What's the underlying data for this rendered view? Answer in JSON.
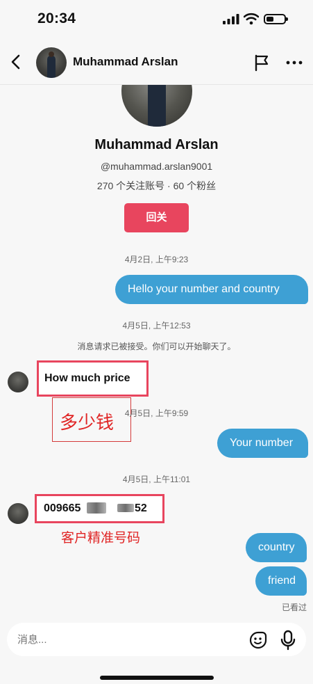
{
  "status_bar": {
    "time": "20:34"
  },
  "header": {
    "name": "Muhammad Arslan"
  },
  "profile": {
    "name": "Muhammad Arslan",
    "handle": "@muhammad.arslan9001",
    "stats": "270 个关注账号 · 60 个粉丝",
    "follow_label": "回关"
  },
  "conversation": {
    "timestamp_1": "4月2日, 上午9:23",
    "msg_out_1": "Hello your number and country",
    "timestamp_2": "4月5日, 上午12:53",
    "system_notice": "消息请求已被接受。你们可以开始聊天了。",
    "msg_in_1": "How much price",
    "annotation_1": "多少钱",
    "timestamp_3": "4月5日, 上午9:59",
    "msg_out_2": "Your number",
    "timestamp_4": "4月5日, 上午11:01",
    "msg_in_2_prefix": "009665",
    "msg_in_2_suffix": "52",
    "annotation_2": "客户精准号码",
    "msg_out_3": "country",
    "msg_out_4": "friend",
    "seen_label": "已看过"
  },
  "composer": {
    "placeholder": "消息..."
  },
  "icons": {
    "back": "chevron-left-icon",
    "flag": "flag-icon",
    "more": "more-horizontal-icon",
    "emoji": "emoji-sticker-icon",
    "mic": "microphone-icon"
  },
  "colors": {
    "outgoing_bubble": "#3ea0d4",
    "follow_button": "#e8455e",
    "annotation_red": "#e02525"
  }
}
